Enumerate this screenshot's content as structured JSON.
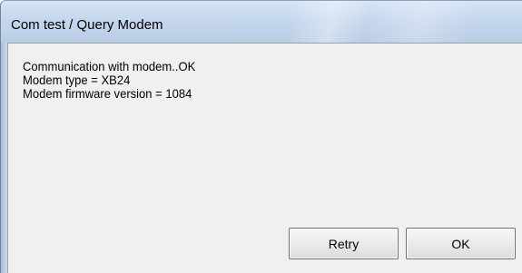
{
  "window": {
    "title": "Com test / Query Modem"
  },
  "message": {
    "lines": [
      "Communication with modem..OK",
      "Modem type = XB24",
      "Modem firmware version = 1084"
    ]
  },
  "buttons": {
    "retry_label": "Retry",
    "ok_label": "OK"
  }
}
